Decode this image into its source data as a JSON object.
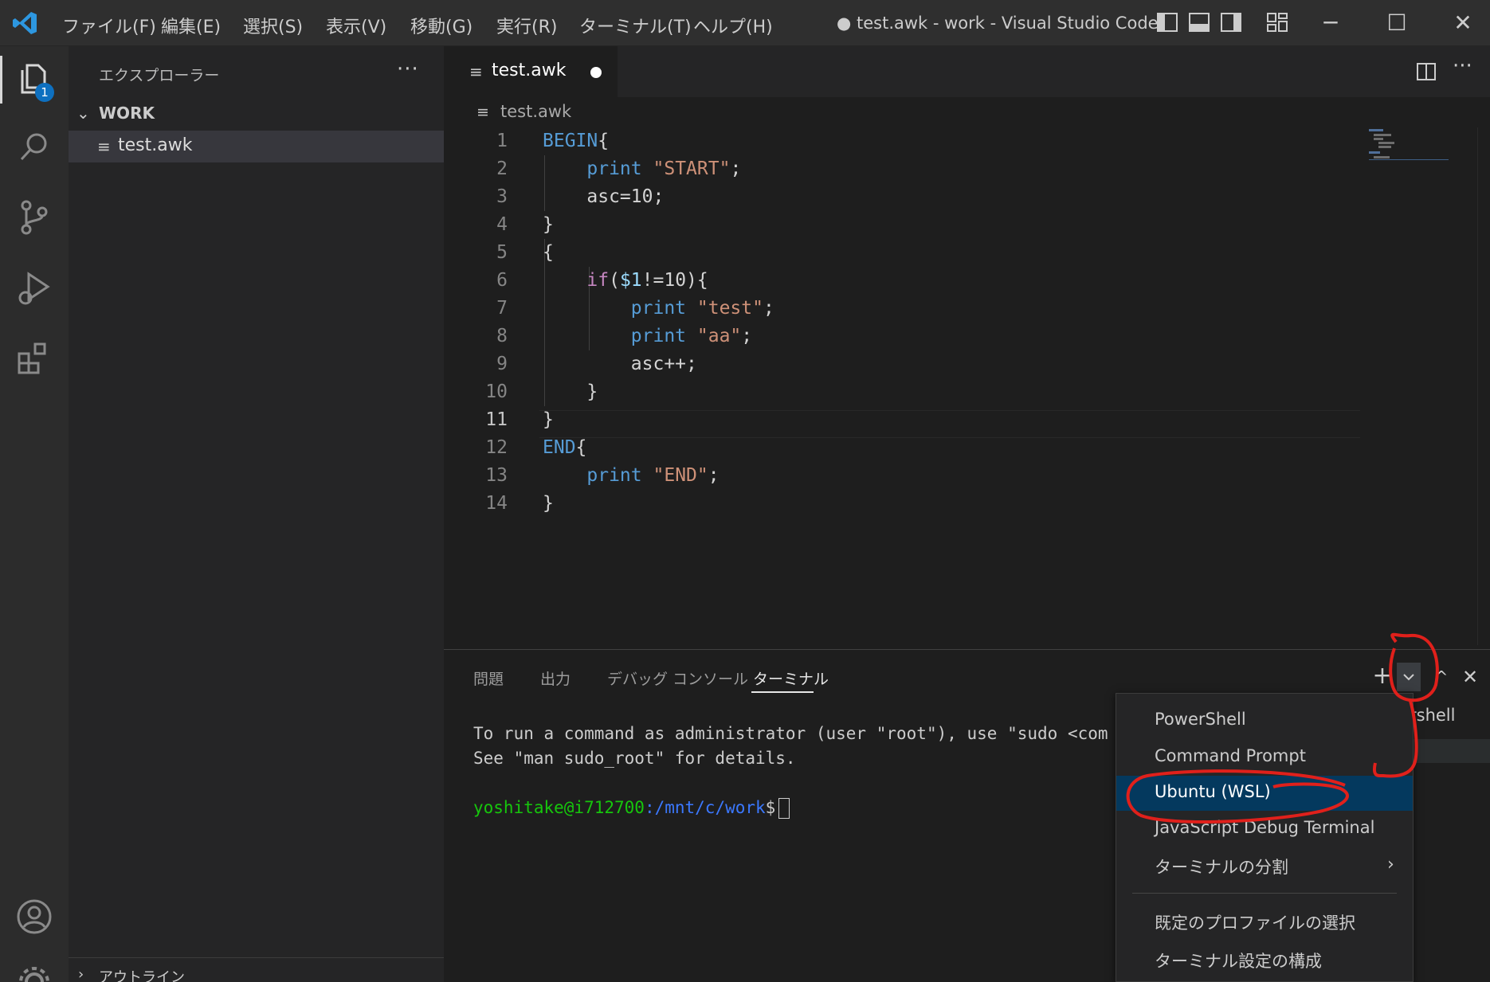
{
  "titlebar": {
    "menus": [
      "ファイル(F)",
      "編集(E)",
      "選択(S)",
      "表示(V)",
      "移動(G)",
      "実行(R)",
      "ターミナル(T)",
      "ヘルプ(H)"
    ],
    "window_title": "● test.awk - work - Visual Studio Code"
  },
  "activity": {
    "explorer_badge": "1"
  },
  "sidebar": {
    "title": "エクスプローラー",
    "more": "···",
    "folder": "WORK",
    "file": "test.awk",
    "outline": "アウトライン"
  },
  "tab": {
    "label": "test.awk",
    "more": "···"
  },
  "breadcrumb": "test.awk",
  "editor": {
    "line_numbers": [
      "1",
      "2",
      "3",
      "4",
      "5",
      "6",
      "7",
      "8",
      "9",
      "10",
      "11",
      "12",
      "13",
      "14"
    ]
  },
  "panel": {
    "tabs": [
      "問題",
      "出力",
      "デバッグ コンソール",
      "ターミナル"
    ],
    "terminal_lines": [
      "To run a command as administrator (user \"root\"), use \"sudo <com",
      "See \"man sudo_root\" for details."
    ],
    "prompt_user": "yoshitake@i712700",
    "prompt_path": ":/mnt/c/work",
    "prompt_symbol": "$",
    "terminal_list_label": "rshell"
  },
  "terminal_menu": {
    "items": [
      "PowerShell",
      "Command Prompt",
      "Ubuntu (WSL)",
      "JavaScript Debug Terminal",
      "ターミナルの分割"
    ],
    "items2": [
      "既定のプロファイルの選択",
      "ターミナル設定の構成"
    ],
    "selected": "Ubuntu (WSL)"
  },
  "colors": {
    "accent": "#0e70c0",
    "selection": "#04395e",
    "annotation": "#e0201b"
  }
}
